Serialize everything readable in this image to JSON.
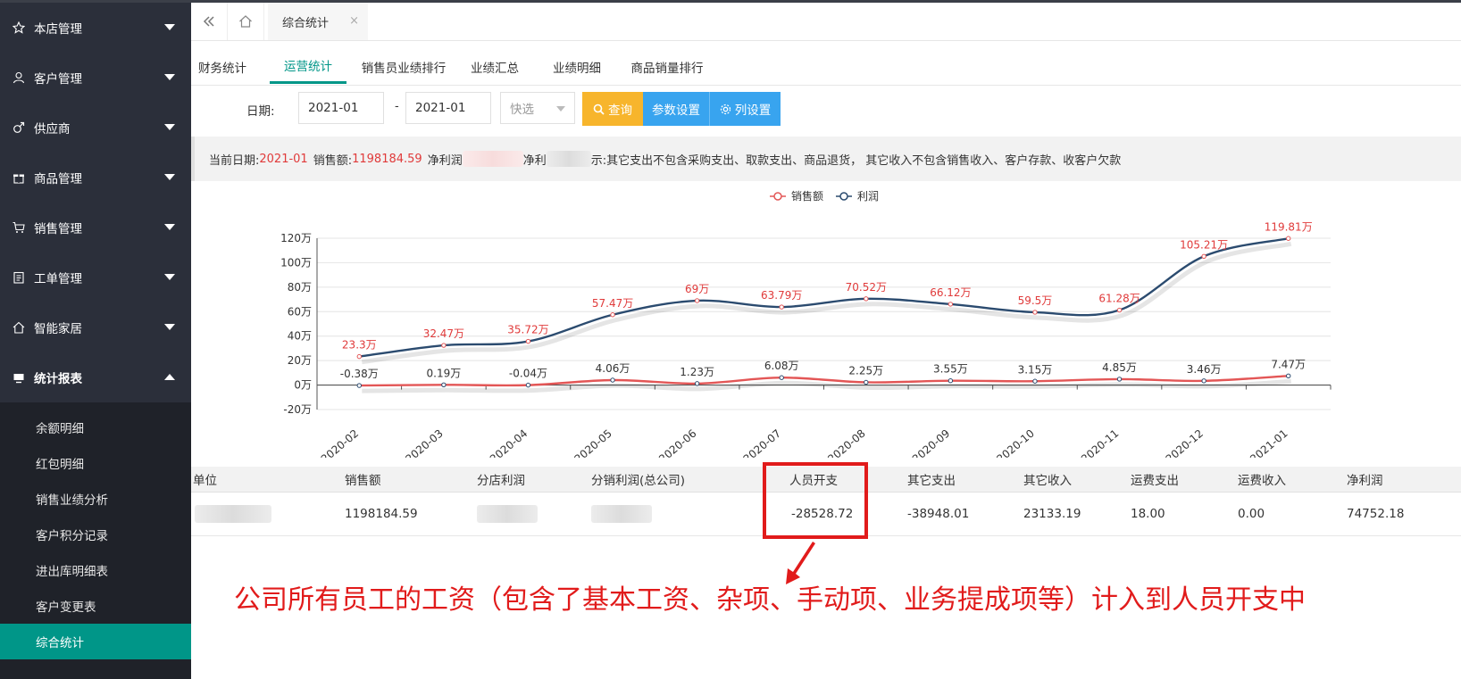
{
  "sidebar": {
    "menus": [
      {
        "label": "本店管理",
        "icon": "star-icon"
      },
      {
        "label": "客户管理",
        "icon": "user-icon"
      },
      {
        "label": "供应商",
        "icon": "male-icon"
      },
      {
        "label": "商品管理",
        "icon": "gift-icon"
      },
      {
        "label": "销售管理",
        "icon": "cart-icon"
      },
      {
        "label": "工单管理",
        "icon": "clipboard-icon"
      },
      {
        "label": "智能家居",
        "icon": "home-icon"
      },
      {
        "label": "统计报表",
        "icon": "monitor-icon"
      }
    ],
    "sub_items": [
      "余额明细",
      "红包明细",
      "销售业绩分析",
      "客户积分记录",
      "进出库明细表",
      "客户变更表",
      "综合统计"
    ]
  },
  "tabbar": {
    "current_tab": "综合统计",
    "close_symbol": "×"
  },
  "subtabs": [
    "财务统计",
    "运营统计",
    "销售员业绩排行",
    "业绩汇总",
    "业绩明细",
    "商品销量排行"
  ],
  "filters": {
    "date_label": "日期:",
    "date_from": "2021-01",
    "dash": "-",
    "date_to": "2021-01",
    "quick_select": "快选",
    "query_btn": "查询",
    "param_btn": "参数设置",
    "column_btn": "列设置",
    "colors": {
      "query": "#f7b52c",
      "param": "#38a4ef",
      "column": "#38a4ef"
    }
  },
  "infobar": {
    "current_date_label": "当前日期:",
    "current_date": "2021-01",
    "sales_label": "销售额:",
    "sales_value": "1198184.59",
    "net_profit_label": "净利润",
    "net_label": "净利",
    "tip_text": "示:其它支出不包含采购支出、取款支出、商品退货， 其它收入不包含销售收入、客户存款、收客户欠款"
  },
  "chart_data": {
    "type": "line",
    "legend": [
      {
        "name": "销售额",
        "color": "#e35656"
      },
      {
        "name": "利润",
        "color": "#2b4b6f"
      }
    ],
    "categories": [
      "2020-02",
      "2020-03",
      "2020-04",
      "2020-05",
      "2020-06",
      "2020-07",
      "2020-08",
      "2020-09",
      "2020-10",
      "2020-11",
      "2020-12",
      "2021-01"
    ],
    "series": [
      {
        "name": "销售额",
        "values": [
          23.3,
          32.47,
          35.72,
          57.47,
          69,
          63.79,
          70.52,
          66.12,
          59.5,
          61.28,
          105.21,
          119.81
        ],
        "labels": [
          "23.3万",
          "32.47万",
          "35.72万",
          "57.47万",
          "69万",
          "63.79万",
          "70.52万",
          "66.12万",
          "59.5万",
          "61.28万",
          "105.21万",
          "119.81万"
        ]
      },
      {
        "name": "利润",
        "values": [
          -0.38,
          0.19,
          -0.04,
          4.06,
          1.23,
          6.08,
          2.25,
          3.55,
          3.15,
          4.85,
          3.46,
          7.47
        ],
        "labels": [
          "-0.38万",
          "0.19万",
          "-0.04万",
          "4.06万",
          "1.23万",
          "6.08万",
          "2.25万",
          "3.55万",
          "3.15万",
          "4.85万",
          "3.46万",
          "7.47万"
        ]
      }
    ],
    "y_ticks": [
      "120万",
      "100万",
      "80万",
      "60万",
      "40万",
      "20万",
      "0万",
      "-20万"
    ],
    "ylim": [
      -20,
      120
    ]
  },
  "table": {
    "headers": [
      "单位",
      "销售额",
      "分店利润",
      "分销利润(总公司)",
      "人员开支",
      "其它支出",
      "其它收入",
      "运费支出",
      "运费收入",
      "净利润"
    ],
    "row": [
      "",
      "1198184.59",
      "",
      "",
      "-28528.72",
      "-38948.01",
      "23133.19",
      "18.00",
      "0.00",
      "74752.18"
    ]
  },
  "annotation": "公司所有员工的工资（包含了基本工资、杂项、手动项、业务提成项等）计入到人员开支中"
}
